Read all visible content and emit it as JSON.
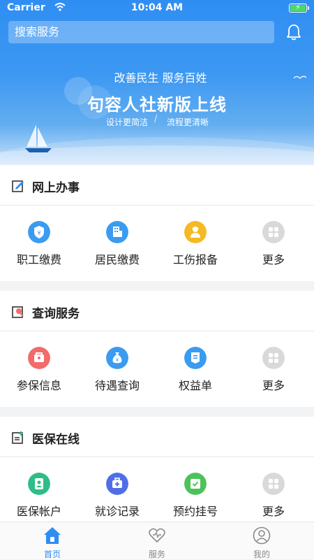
{
  "status_bar": {
    "carrier": "Carrier",
    "time": "10:04 AM"
  },
  "search": {
    "placeholder": "搜索服务"
  },
  "banner": {
    "subtitle": "改善民生 服务百姓",
    "title": "句容人社新版上线",
    "tag_left": "设计更简洁",
    "tag_right": "流程更清晰",
    "separator": "/"
  },
  "sections": [
    {
      "title": "网上办事",
      "items": [
        {
          "label": "职工缴费",
          "icon": "yuan-shield-icon",
          "color": "#3a9bf0"
        },
        {
          "label": "居民缴费",
          "icon": "building-icon",
          "color": "#3a9bf0"
        },
        {
          "label": "工伤报备",
          "icon": "worker-icon",
          "color": "#f5b923"
        },
        {
          "label": "更多",
          "icon": "grid-icon",
          "color": "#d9d9d9"
        }
      ]
    },
    {
      "title": "查询服务",
      "items": [
        {
          "label": "参保信息",
          "icon": "insurance-icon",
          "color": "#f26b6b"
        },
        {
          "label": "待遇查询",
          "icon": "money-bag-icon",
          "color": "#3a9bf0"
        },
        {
          "label": "权益单",
          "icon": "document-icon",
          "color": "#3a9bf0"
        },
        {
          "label": "更多",
          "icon": "grid-icon",
          "color": "#d9d9d9"
        }
      ]
    },
    {
      "title": "医保在线",
      "items": [
        {
          "label": "医保帐户",
          "icon": "account-icon",
          "color": "#2dbd86"
        },
        {
          "label": "就诊记录",
          "icon": "medical-kit-icon",
          "color": "#4f6ee8"
        },
        {
          "label": "预约挂号",
          "icon": "calendar-check-icon",
          "color": "#4cc25a"
        },
        {
          "label": "更多",
          "icon": "grid-icon",
          "color": "#d9d9d9"
        }
      ]
    }
  ],
  "tabbar": [
    {
      "label": "首页",
      "icon": "home-icon",
      "active": true
    },
    {
      "label": "服务",
      "icon": "heart-icon",
      "active": false
    },
    {
      "label": "我的",
      "icon": "user-icon",
      "active": false
    }
  ],
  "colors": {
    "primary": "#2f8ef3",
    "tab_inactive": "#8a8a8a"
  }
}
